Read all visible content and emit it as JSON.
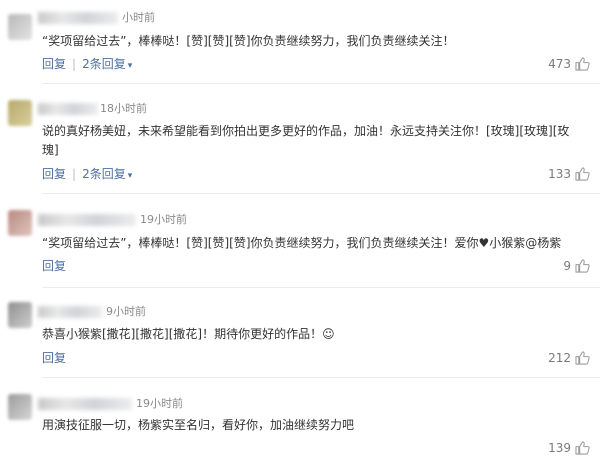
{
  "comments": [
    {
      "time": "小时前",
      "text": "“奖项留给过去”，棒棒哒！[赞][赞][赞]你负责继续努力，我们负责继续关注！",
      "reply_label": "回复",
      "sub_replies_label": "2条回复",
      "likes": "473"
    },
    {
      "time": "18小时前",
      "text": "说的真好杨美妞，未来希望能看到你拍出更多更好的作品，加油！永远支持关注你！[玫瑰][玫瑰][玫瑰]",
      "reply_label": "回复",
      "sub_replies_label": "2条回复",
      "likes": "133"
    },
    {
      "time": "19小时前",
      "text": "“奖项留给过去”，棒棒哒！[赞][赞][赞]你负责继续努力，我们负责继续关注！爱你♥小猴紫@杨紫",
      "reply_label": "回复",
      "likes": "9"
    },
    {
      "time": "9小时前",
      "text": "恭喜小猴紫[撒花][撒花][撒花]！期待你更好的作品！☺",
      "reply_label": "回复",
      "likes": "212"
    },
    {
      "time": "19小时前",
      "text": "用演技征服一切，杨紫实至名归，看好你，加油继续努力吧",
      "likes": "139"
    }
  ],
  "icons": {
    "like": "thumbs-up-icon",
    "expand": "chevron-down-icon"
  },
  "colors": {
    "link": "#4e6fa1",
    "meta": "#8a8a8a",
    "text": "#333333"
  }
}
